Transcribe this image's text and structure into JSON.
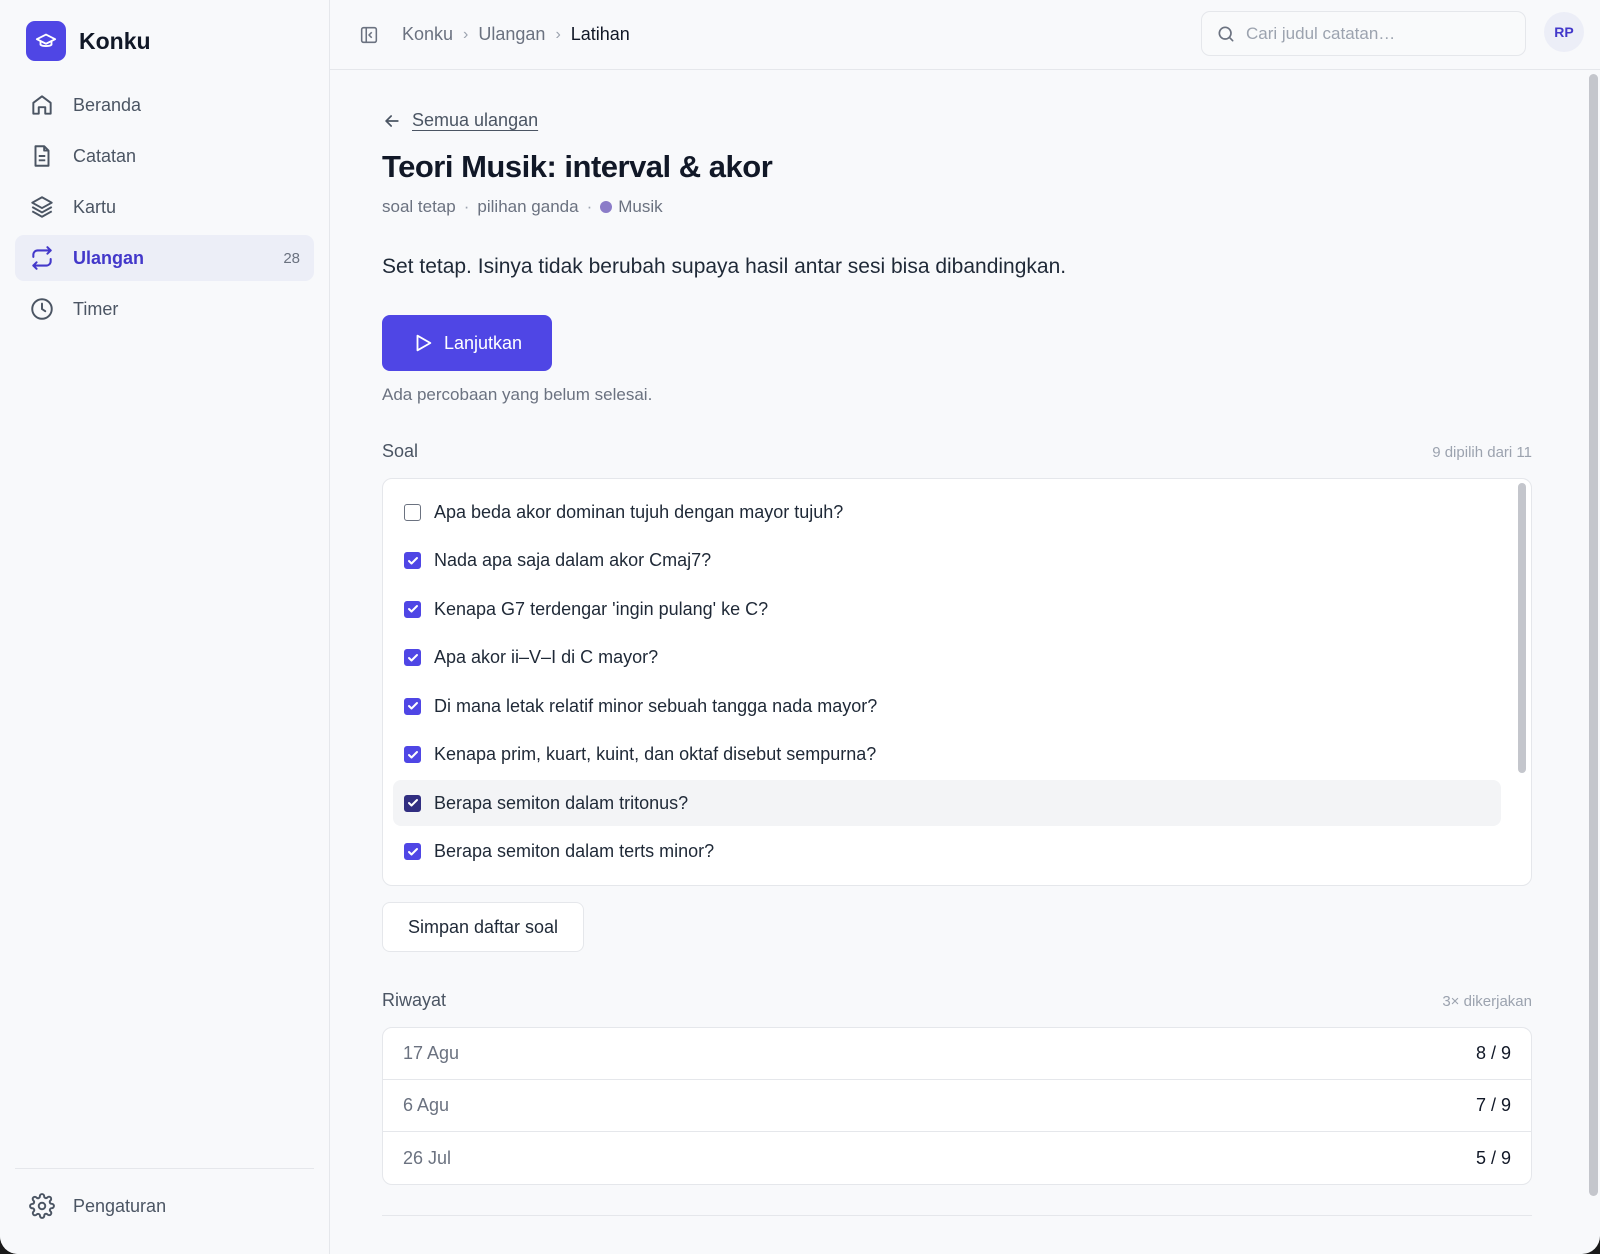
{
  "app": {
    "name": "Konku"
  },
  "sidebar": {
    "items": [
      {
        "label": "Beranda",
        "icon": "home-icon"
      },
      {
        "label": "Catatan",
        "icon": "document-icon"
      },
      {
        "label": "Kartu",
        "icon": "layers-icon"
      },
      {
        "label": "Ulangan",
        "icon": "repeat-icon",
        "count": "28",
        "active": true
      },
      {
        "label": "Timer",
        "icon": "clock-icon"
      }
    ],
    "settings_label": "Pengaturan"
  },
  "topbar": {
    "breadcrumb": [
      "Konku",
      "Ulangan",
      "Latihan"
    ],
    "search_placeholder": "Cari judul catatan…",
    "avatar_initials": "RP"
  },
  "page": {
    "back_label": "Semua ulangan",
    "title": "Teori Musik: interval & akor",
    "meta": {
      "type": "soal tetap",
      "format": "pilihan ganda",
      "tag": "Musik",
      "tag_color": "#8b7cc8"
    },
    "description": "Set tetap. Isinya tidak berubah supaya hasil antar sesi bisa dibandingkan.",
    "continue_label": "Lanjutkan",
    "continue_note": "Ada percobaan yang belum selesai."
  },
  "questions": {
    "title": "Soal",
    "summary": "9 dipilih dari 11",
    "items": [
      {
        "text": "Apa beda akor dominan tujuh dengan mayor tujuh?",
        "checked": false
      },
      {
        "text": "Nada apa saja dalam akor Cmaj7?",
        "checked": true
      },
      {
        "text": "Kenapa G7 terdengar 'ingin pulang' ke C?",
        "checked": true
      },
      {
        "text": "Apa akor ii–V–I di C mayor?",
        "checked": true
      },
      {
        "text": "Di mana letak relatif minor sebuah tangga nada mayor?",
        "checked": true
      },
      {
        "text": "Kenapa prim, kuart, kuint, dan oktaf disebut sempurna?",
        "checked": true
      },
      {
        "text": "Berapa semiton dalam tritonus?",
        "checked": true
      },
      {
        "text": "Berapa semiton dalam terts minor?",
        "checked": true
      }
    ],
    "save_label": "Simpan daftar soal"
  },
  "history": {
    "title": "Riwayat",
    "summary": "3× dikerjakan",
    "rows": [
      {
        "date": "17 Agu",
        "score": "8 / 9"
      },
      {
        "date": "6 Agu",
        "score": "7 / 9"
      },
      {
        "date": "26 Jul",
        "score": "5 / 9"
      }
    ]
  },
  "colors": {
    "accent": "#4f46e5",
    "accent_text": "#4338ca",
    "active_bg": "#eceef7"
  }
}
